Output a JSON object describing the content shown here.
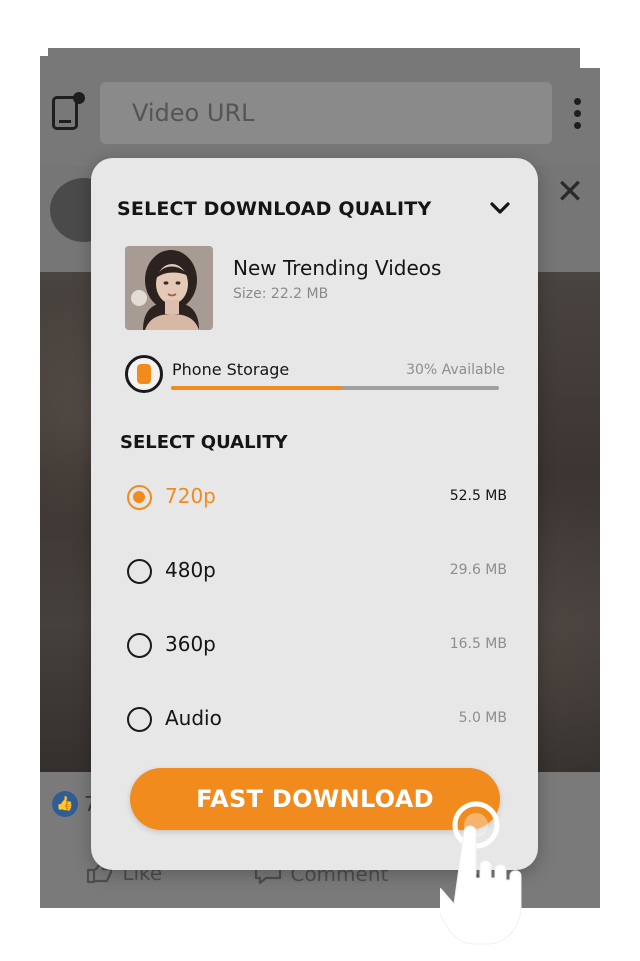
{
  "browser": {
    "url_placeholder": "Video URL"
  },
  "background": {
    "like_count": "7",
    "actions": [
      "Like",
      "Comment"
    ]
  },
  "modal": {
    "title": "SELECT DOWNLOAD QUALITY",
    "video": {
      "title": "New Trending Videos",
      "size": "Size: 22.2 MB"
    },
    "storage": {
      "label": "Phone Storage",
      "available": "30% Available",
      "used_fraction": 0.52
    },
    "quality_heading": "SELECT QUALITY",
    "options": [
      {
        "label": "720p",
        "size": "52.5 MB",
        "selected": true
      },
      {
        "label": "480p",
        "size": "29.6 MB",
        "selected": false
      },
      {
        "label": "360p",
        "size": "16.5 MB",
        "selected": false
      },
      {
        "label": "Audio",
        "size": "5.0 MB",
        "selected": false
      }
    ],
    "download_label": "FAST DOWNLOAD"
  },
  "colors": {
    "accent": "#f28b1e",
    "card": "#e7e7e7",
    "text": "#151515",
    "muted": "#8e8e8e"
  },
  "icons": [
    "tabs-icon",
    "more-vert-icon",
    "close-icon",
    "chevron-down-icon",
    "phone-storage-icon",
    "like-icon",
    "comment-icon",
    "share-icon",
    "tap-hand-icon"
  ]
}
